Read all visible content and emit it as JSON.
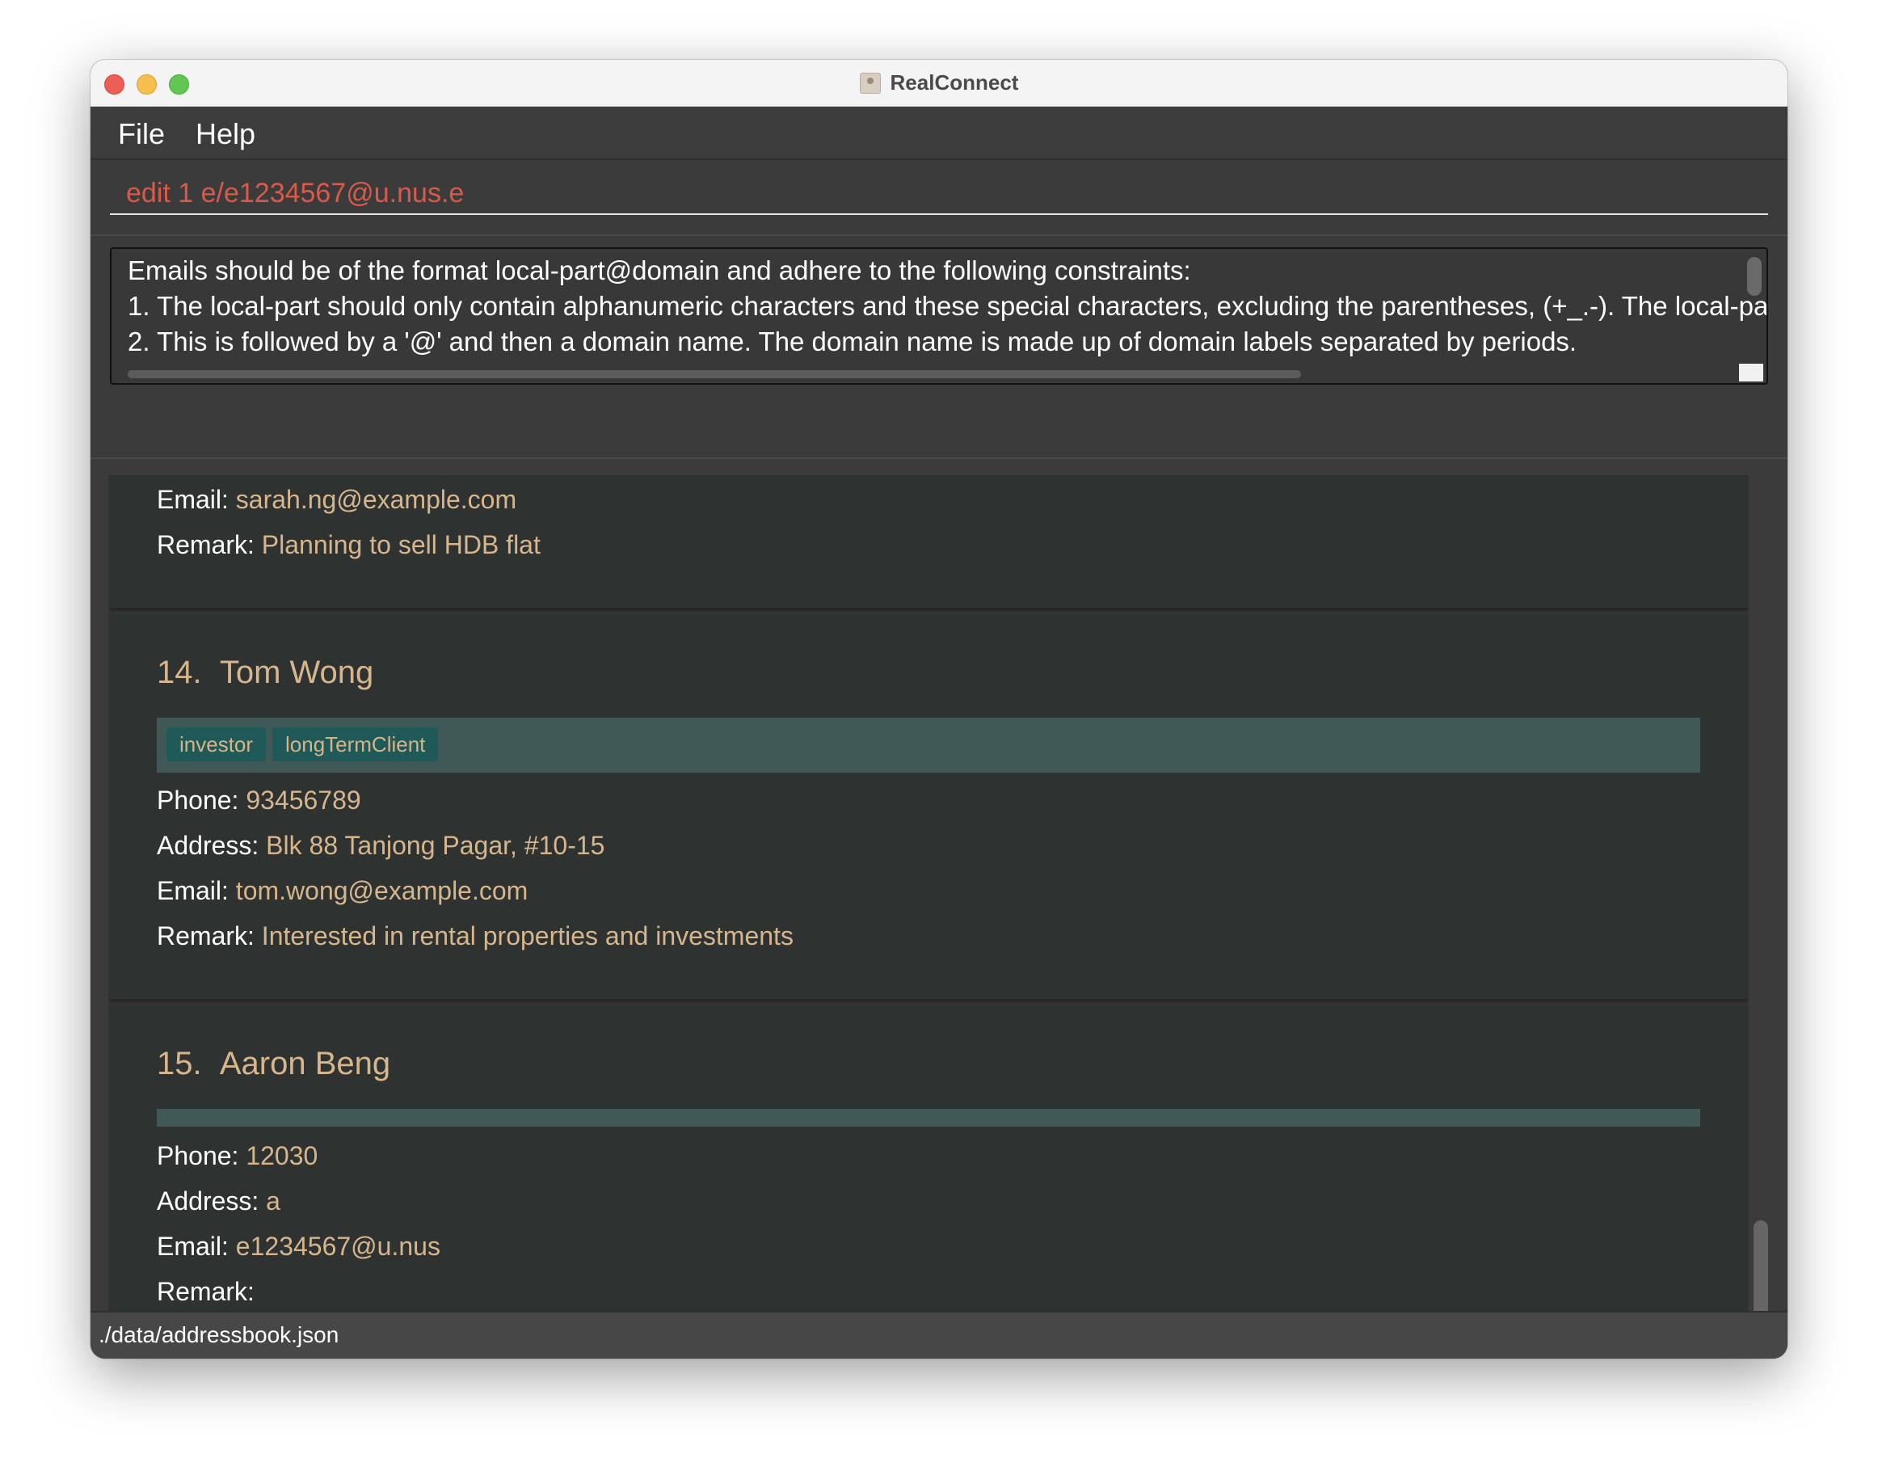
{
  "window": {
    "title": "RealConnect"
  },
  "menu": {
    "file": "File",
    "help": "Help"
  },
  "command": {
    "value": "edit 1 e/e1234567@u.nus.e"
  },
  "result": {
    "lines": [
      "Emails should be of the format local-part@domain and adhere to the following constraints:",
      "1. The local-part should only contain alphanumeric characters and these special characters, excluding the parentheses, (+_.-). The local-pa",
      "2. This is followed by a '@' and then a domain name. The domain name is made up of domain labels separated by periods."
    ]
  },
  "labels": {
    "phone": "Phone: ",
    "address": "Address: ",
    "email": "Email: ",
    "remark": "Remark: "
  },
  "cards": [
    {
      "email": "sarah.ng@example.com",
      "remark": "Planning to sell HDB flat"
    },
    {
      "index": "14.",
      "name": "Tom Wong",
      "tags": [
        "investor",
        "longTermClient"
      ],
      "phone": "93456789",
      "address": "Blk 88 Tanjong Pagar, #10-15",
      "email": "tom.wong@example.com",
      "remark": "Interested in rental properties and investments"
    },
    {
      "index": "15.",
      "name": "Aaron Beng",
      "tags": [],
      "phone": "12030",
      "address": "a",
      "email": "e1234567@u.nus",
      "remark": ""
    }
  ],
  "status": {
    "file_path": "./data/addressbook.json"
  },
  "colors": {
    "command_error": "#d85a4a",
    "value_text": "#d7b68e",
    "tag_background": "#1f5a58",
    "card_background": "#2e3332"
  }
}
